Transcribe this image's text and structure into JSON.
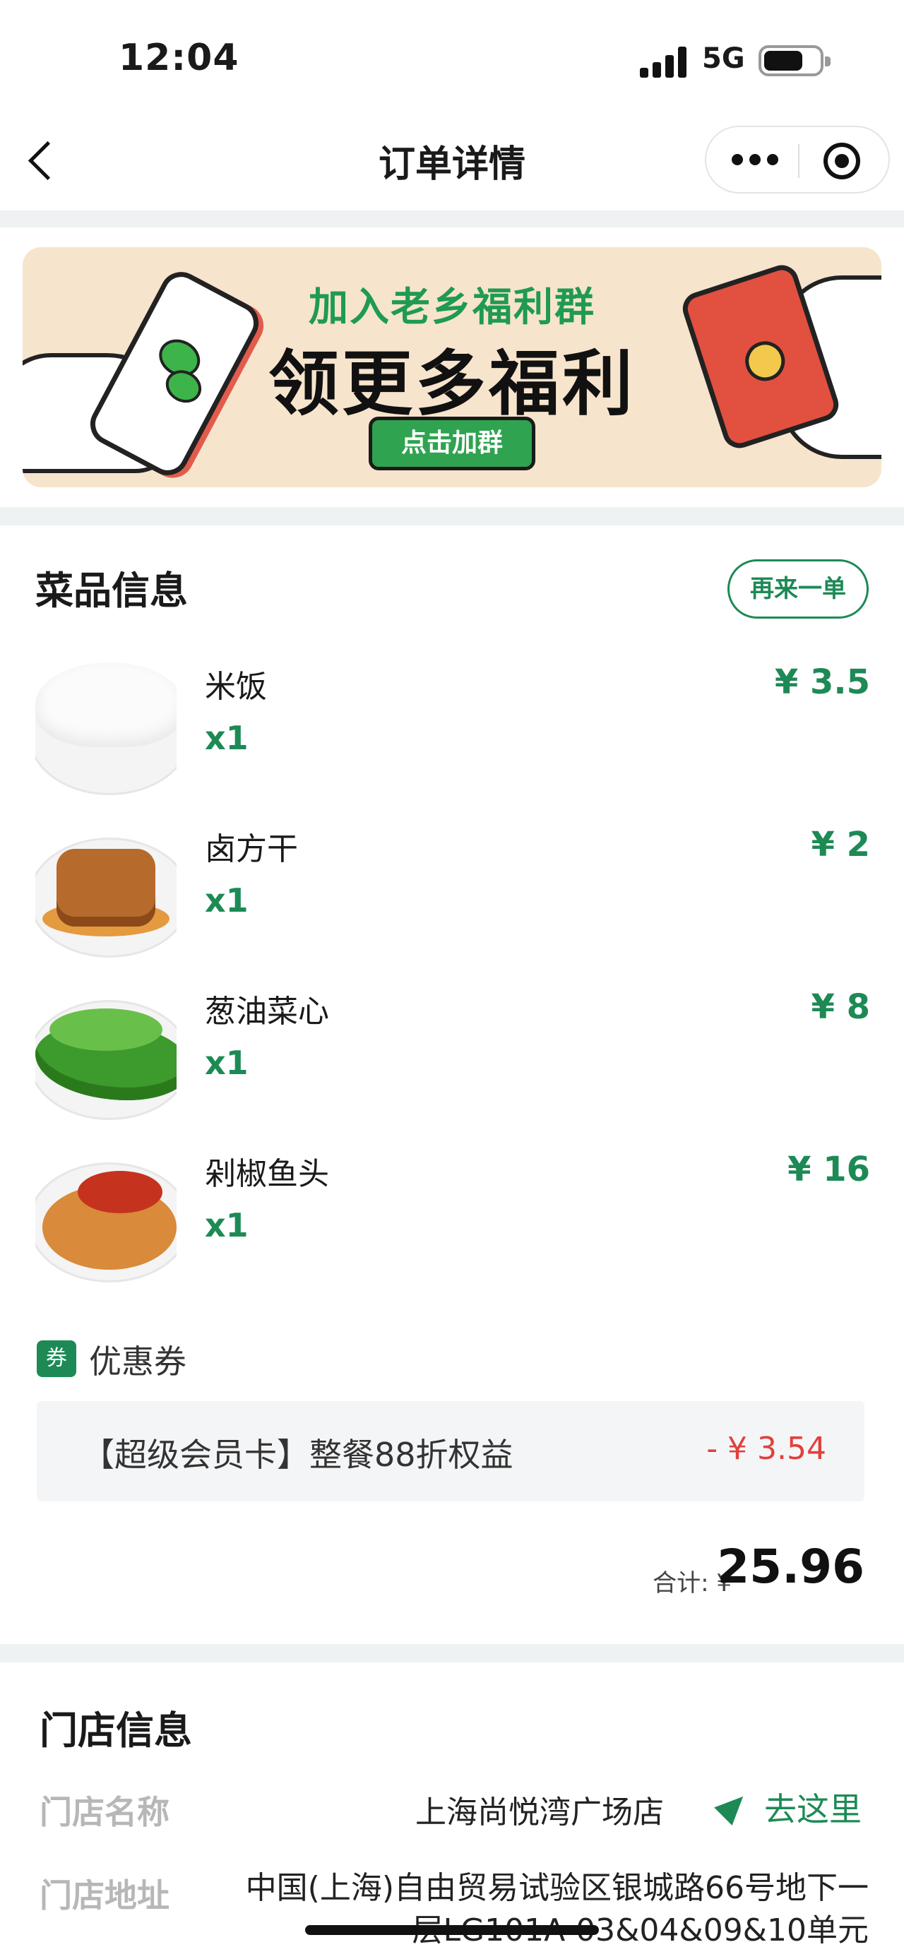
{
  "status_bar": {
    "time": "12:04",
    "network": "5G"
  },
  "nav": {
    "title": "订单详情"
  },
  "banner": {
    "line1": "加入老乡福利群",
    "line2": "领更多福利",
    "button": "点击加群"
  },
  "dishes_section": {
    "title": "菜品信息",
    "reorder_label": "再来一单",
    "items": [
      {
        "name": "米饭",
        "qty": "x1",
        "price": "¥ 3.5"
      },
      {
        "name": "卤方干",
        "qty": "x1",
        "price": "¥ 2"
      },
      {
        "name": "葱油菜心",
        "qty": "x1",
        "price": "¥ 8"
      },
      {
        "name": "剁椒鱼头",
        "qty": "x1",
        "price": "¥ 16"
      }
    ]
  },
  "coupon": {
    "badge": "券",
    "label": "优惠券",
    "name": "【超级会员卡】整餐88折权益",
    "amount": "- ¥ 3.54"
  },
  "total": {
    "label": "合计: ¥",
    "value": "25.96"
  },
  "store": {
    "title": "门店信息",
    "name_label": "门店名称",
    "name": "上海尚悦湾广场店",
    "goto_label": "去这里",
    "address_label": "门店地址",
    "address": "中国(上海)自由贸易试验区银城路66号地下一层LG101A-03&04&09&10单元"
  },
  "colors": {
    "accent": "#1d8a55",
    "discount": "#e1403a",
    "section_gap": "#eef2f2"
  }
}
